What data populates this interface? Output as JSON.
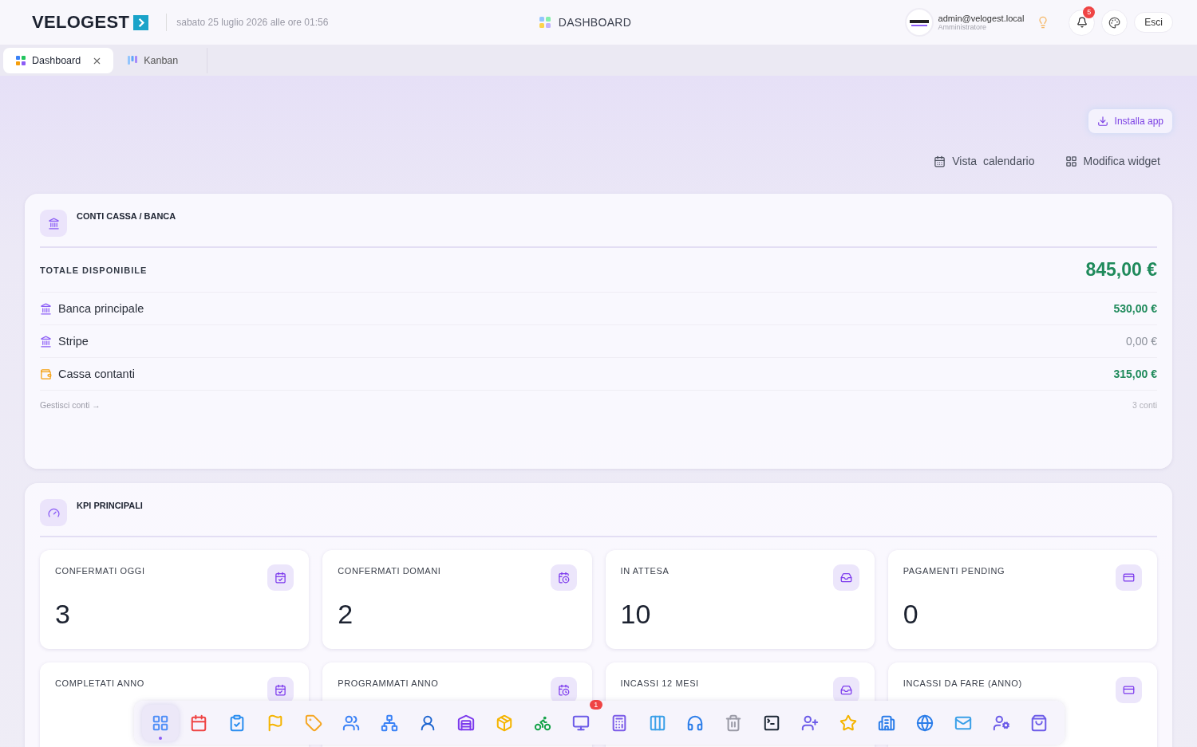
{
  "header": {
    "brand": "VELOGEST",
    "datetime": "sabato 25 luglio 2026 alle ore 01:56",
    "page_title": "DASHBOARD",
    "user": {
      "email": "admin@velogest.local",
      "role": "Amministratore"
    },
    "notifications": {
      "badge": "5"
    },
    "logout": "Esci"
  },
  "tabs": [
    {
      "label": "Dashboard",
      "selected": true,
      "closable": true
    },
    {
      "label": "Kanban",
      "selected": false,
      "closable": false
    }
  ],
  "toolbar": {
    "install": "Installa app",
    "actions": [
      "Vista  calendario",
      "Modifica widget"
    ]
  },
  "accounts": {
    "title": "CONTI CASSA / BANCA",
    "total_label": "TOTALE DISPONIBILE",
    "total": "845,00 €",
    "rows": [
      {
        "kind": "bank",
        "name": "Banca principale",
        "amount": "530,00 €",
        "positive": true
      },
      {
        "kind": "bank",
        "name": "Stripe",
        "amount": "0,00 €",
        "positive": false
      },
      {
        "kind": "cash",
        "name": "Cassa contanti",
        "amount": "315,00 €",
        "positive": true
      }
    ],
    "manage_link": "Gestisci conti →",
    "count": "3 conti"
  },
  "kpi": {
    "title": "KPI PRINCIPALI",
    "cards": [
      {
        "label": "CONFERMATI OGGI",
        "value": "3"
      },
      {
        "label": "CONFERMATI DOMANI",
        "value": "2"
      },
      {
        "label": "IN ATTESA",
        "value": "10"
      },
      {
        "label": "PAGAMENTI PENDING",
        "value": "0"
      },
      {
        "label": "COMPLETATI ANNO"
      },
      {
        "label": "PROGRAMMATI ANNO"
      },
      {
        "label": "INCASSI 12 MESI"
      },
      {
        "label": "INCASSI DA FARE (ANNO)"
      }
    ]
  },
  "dock": [
    {
      "selected": true
    },
    {
      "selected": false
    },
    {
      "selected": false
    },
    {
      "selected": false
    },
    {
      "selected": false
    },
    {
      "selected": false
    },
    {
      "selected": false
    },
    {
      "selected": false
    },
    {
      "selected": false
    },
    {
      "selected": false
    },
    {
      "selected": false
    },
    {
      "selected": false,
      "badge": "1"
    },
    {
      "selected": false
    },
    {
      "selected": false
    },
    {
      "selected": false
    },
    {
      "selected": false
    },
    {
      "selected": false
    },
    {
      "selected": false
    },
    {
      "selected": false
    },
    {
      "selected": false
    },
    {
      "selected": false
    },
    {
      "selected": false
    },
    {
      "selected": false
    },
    {
      "selected": false
    }
  ]
}
